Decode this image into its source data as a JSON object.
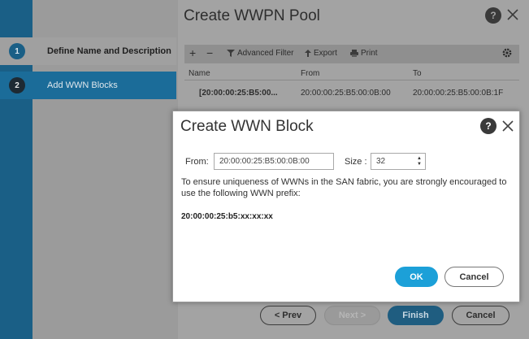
{
  "wizard": {
    "title": "Create WWPN Pool",
    "steps": [
      {
        "num": "1",
        "label": "Define Name and Description"
      },
      {
        "num": "2",
        "label": "Add WWN Blocks"
      }
    ],
    "toolbar": {
      "add": "+",
      "remove": "−",
      "advanced_filter": "Advanced Filter",
      "export": "Export",
      "print": "Print"
    },
    "table": {
      "columns": [
        "Name",
        "From",
        "To"
      ],
      "rows": [
        {
          "name": "[20:00:00:25:B5:00...",
          "from": "20:00:00:25:B5:00:0B:00",
          "to": "20:00:00:25:B5:00:0B:1F"
        }
      ]
    },
    "buttons": {
      "prev": "< Prev",
      "next": "Next >",
      "finish": "Finish",
      "cancel": "Cancel"
    }
  },
  "dialog": {
    "title": "Create WWN Block",
    "from_label": "From:",
    "from_value": "20:00:00:25:B5:00:0B:00",
    "size_label": "Size :",
    "size_value": "32",
    "message": "To ensure uniqueness of WWNs in the SAN fabric, you are strongly encouraged to use the following WWN prefix:",
    "prefix": "20:00:00:25:b5:xx:xx:xx",
    "ok": "OK",
    "cancel": "Cancel"
  },
  "help_glyph": "?",
  "colors": {
    "accent": "#1ca0d8",
    "sidebar_active": "#1b6c99",
    "finish": "#1f5d80"
  }
}
